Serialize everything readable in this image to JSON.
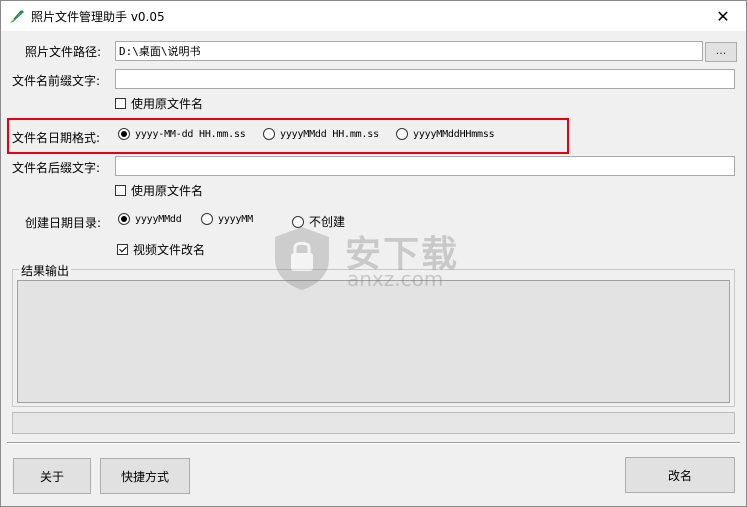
{
  "window": {
    "title": "照片文件管理助手 v0.05",
    "close_glyph": "✕"
  },
  "form": {
    "path_label": "照片文件路径:",
    "path_value": "D:\\桌面\\说明书",
    "browse_label": "...",
    "prefix_label": "文件名前缀文字:",
    "prefix_value": "",
    "prefix_use_original_label": "使用原文件名",
    "prefix_use_original_checked": false,
    "date_format_label": "文件名日期格式:",
    "date_formats": [
      {
        "label": "yyyy-MM-dd HH.mm.ss",
        "checked": true
      },
      {
        "label": "yyyyMMdd HH.mm.ss",
        "checked": false
      },
      {
        "label": "yyyyMMddHHmmss",
        "checked": false
      }
    ],
    "suffix_label": "文件名后缀文字:",
    "suffix_value": "",
    "suffix_use_original_label": "使用原文件名",
    "suffix_use_original_checked": false,
    "date_dir_label": "创建日期目录:",
    "date_dir_options": [
      {
        "label": "yyyyMMdd",
        "checked": true
      },
      {
        "label": "yyyyMM",
        "checked": false
      },
      {
        "label": "不创建",
        "checked": false
      }
    ],
    "video_rename_label": "视频文件改名",
    "video_rename_checked": true
  },
  "output": {
    "group_title": "结果输出",
    "text": ""
  },
  "progress": {
    "value": 0
  },
  "buttons": {
    "about": "关于",
    "shortcut": "快捷方式",
    "rename": "改名"
  },
  "watermark": {
    "cn": "安下载",
    "en": "anxz.com"
  },
  "colors": {
    "highlight": "#e60012",
    "window_bg": "#f0f0f0"
  }
}
